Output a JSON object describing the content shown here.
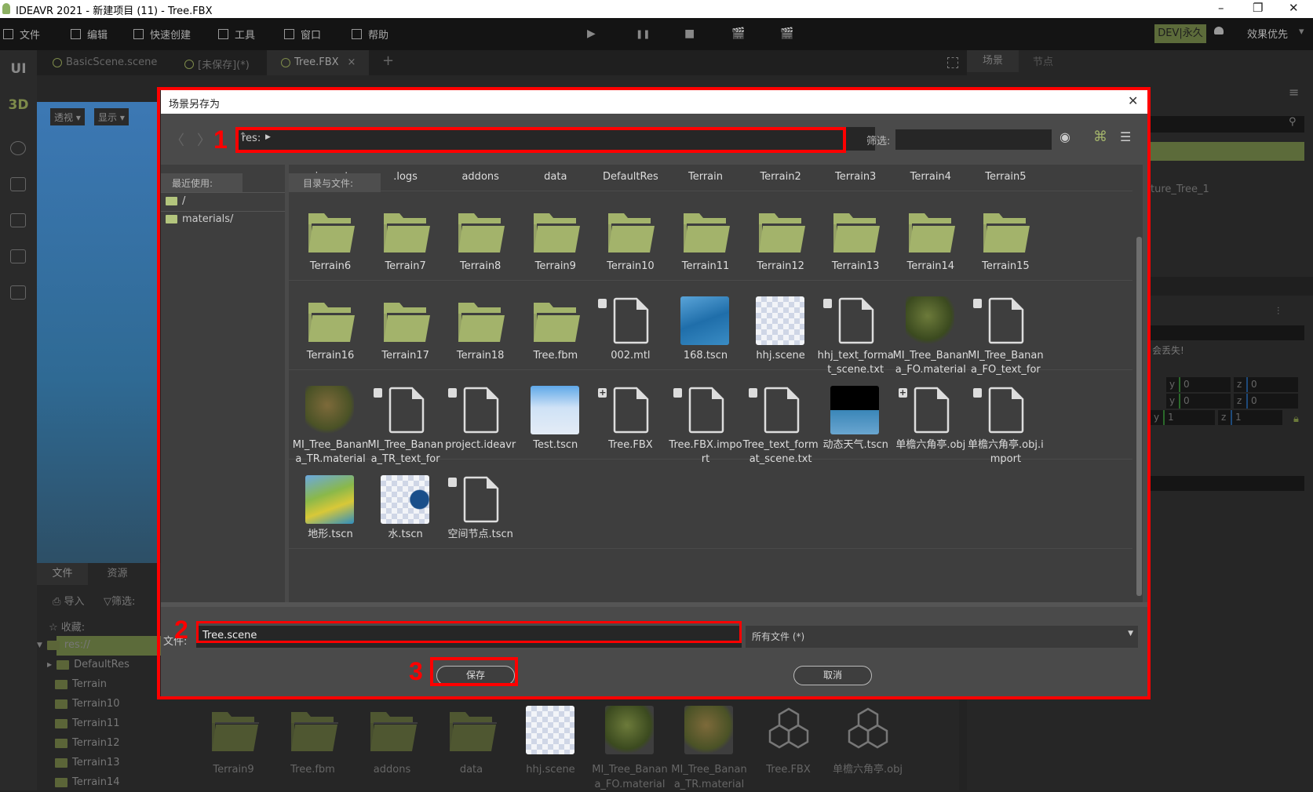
{
  "window": {
    "title": "IDEAVR 2021 - 新建项目 (11) - Tree.FBX",
    "minimize": "–",
    "maximize": "❐",
    "close": "✕"
  },
  "menu": [
    {
      "label": "文件"
    },
    {
      "label": "编辑"
    },
    {
      "label": "快速创建"
    },
    {
      "label": "工具"
    },
    {
      "label": "窗口"
    },
    {
      "label": "帮助"
    }
  ],
  "controls": {
    "play": "▶",
    "pause": "❚❚",
    "stop": "■",
    "film1": "🎬",
    "film2": "🎬"
  },
  "toolbar_right": {
    "license": "DEV|永久",
    "quality": "效果优先",
    "caret": "▾"
  },
  "leftstrip": {
    "ui": "UI",
    "d3": "3D",
    "accent": "#7d8a4a"
  },
  "tabs": [
    {
      "label": "BasicScene.scene"
    },
    {
      "label": "[未保存](*)"
    },
    {
      "label": "Tree.FBX",
      "active": true
    }
  ],
  "tab_add": "+",
  "tab_close": "×",
  "right_tabs": [
    {
      "label": "场景"
    },
    {
      "label": "节点"
    }
  ],
  "viewport": {
    "perspective": "透视 ▾",
    "display": "显示 ▾"
  },
  "fsdock": {
    "tabs": [
      "文件",
      "资源"
    ],
    "import": "导入",
    "filter": "筛选:",
    "favorites": "收藏:",
    "root": "res://",
    "tree": [
      "DefaultRes",
      "Terrain",
      "Terrain10",
      "Terrain11",
      "Terrain12",
      "Terrain13",
      "Terrain14"
    ]
  },
  "bgbrowser": [
    {
      "label": "Terrain9",
      "type": "folder"
    },
    {
      "label": "Tree.fbm",
      "type": "folder"
    },
    {
      "label": "addons",
      "type": "folder"
    },
    {
      "label": "data",
      "type": "folder"
    },
    {
      "label": "hhj.scene",
      "type": "checker"
    },
    {
      "label": "MI_Tree_Banana_FO.material",
      "type": "sphere"
    },
    {
      "label": "MI_Tree_Banana_TR.material",
      "type": "sphere2"
    },
    {
      "label": "Tree.FBX",
      "type": "cube"
    },
    {
      "label": "单檐六角亭.obj",
      "type": "cube"
    }
  ],
  "rightpanel": {
    "node": "ture_Tree_1",
    "warning": "会丢失!",
    "rows": [
      [
        "y",
        "0",
        "z",
        "0"
      ],
      [
        "y",
        "0",
        "z",
        "0"
      ],
      [
        "y",
        "1",
        "z",
        "1"
      ]
    ]
  },
  "dialog": {
    "title": "场景另存为",
    "close": "✕",
    "path": "res:",
    "filter_label": "筛选:",
    "filter_value": "",
    "recent_label": "最近使用:",
    "recent": [
      "/",
      "materials/"
    ],
    "files_label": "目录与文件:",
    "rows": [
      [
        {
          "l": ".import",
          "t": "folder"
        },
        {
          "l": ".logs",
          "t": "folder"
        },
        {
          "l": "addons",
          "t": "folder"
        },
        {
          "l": "data",
          "t": "folder"
        },
        {
          "l": "DefaultRes",
          "t": "folder"
        },
        {
          "l": "Terrain",
          "t": "folder"
        },
        {
          "l": "Terrain2",
          "t": "folder"
        },
        {
          "l": "Terrain3",
          "t": "folder"
        },
        {
          "l": "Terrain4",
          "t": "folder"
        },
        {
          "l": "Terrain5",
          "t": "folder"
        }
      ],
      [
        {
          "l": "Terrain6",
          "t": "folder"
        },
        {
          "l": "Terrain7",
          "t": "folder"
        },
        {
          "l": "Terrain8",
          "t": "folder"
        },
        {
          "l": "Terrain9",
          "t": "folder"
        },
        {
          "l": "Terrain10",
          "t": "folder"
        },
        {
          "l": "Terrain11",
          "t": "folder"
        },
        {
          "l": "Terrain12",
          "t": "folder"
        },
        {
          "l": "Terrain13",
          "t": "folder"
        },
        {
          "l": "Terrain14",
          "t": "folder"
        },
        {
          "l": "Terrain15",
          "t": "folder"
        }
      ],
      [
        {
          "l": "Terrain16",
          "t": "folder"
        },
        {
          "l": "Terrain17",
          "t": "folder"
        },
        {
          "l": "Terrain18",
          "t": "folder"
        },
        {
          "l": "Tree.fbm",
          "t": "folder"
        },
        {
          "l": "002.mtl",
          "t": "file",
          "b": "cube"
        },
        {
          "l": "168.tscn",
          "t": "water"
        },
        {
          "l": "hhj.scene",
          "t": "checker"
        },
        {
          "l": "hhj_text_format_scene.txt",
          "t": "file",
          "b": "cube"
        },
        {
          "l": "MI_Tree_Banana_FO.material",
          "t": "sphere"
        },
        {
          "l": "MI_Tree_Banana_FO_text_for",
          "t": "file",
          "b": "cube"
        }
      ],
      [
        {
          "l": "MI_Tree_Banana_TR.material",
          "t": "sphere2"
        },
        {
          "l": "MI_Tree_Banana_TR_text_for",
          "t": "file",
          "b": "cube"
        },
        {
          "l": "project.ideavr",
          "t": "file",
          "b": "cube"
        },
        {
          "l": "Test.tscn",
          "t": "sky"
        },
        {
          "l": "Tree.FBX",
          "t": "file",
          "b": "plus"
        },
        {
          "l": "Tree.FBX.import",
          "t": "file",
          "b": "cube"
        },
        {
          "l": "Tree_text_format_scene.txt",
          "t": "file",
          "b": "cube"
        },
        {
          "l": "动态天气.tscn",
          "t": "weather"
        },
        {
          "l": "单檐六角亭.obj",
          "t": "file",
          "b": "plus"
        },
        {
          "l": "单檐六角亭.obj.import",
          "t": "file",
          "b": "cube"
        }
      ],
      [
        {
          "l": "地形.tscn",
          "t": "terrain"
        },
        {
          "l": "水.tscn",
          "t": "ball"
        },
        {
          "l": "空间节点.tscn",
          "t": "file",
          "b": "cube"
        }
      ]
    ],
    "filename_label": "文件:",
    "filename": "Tree.scene",
    "filetype": "所有文件 (*)",
    "save": "保存",
    "cancel": "取消"
  },
  "annotations": {
    "n1": "1",
    "n2": "2",
    "n3": "3",
    "color": "#ff0000"
  },
  "colors": {
    "folder": "#a3b36b",
    "accent": "#5c6b3a"
  }
}
